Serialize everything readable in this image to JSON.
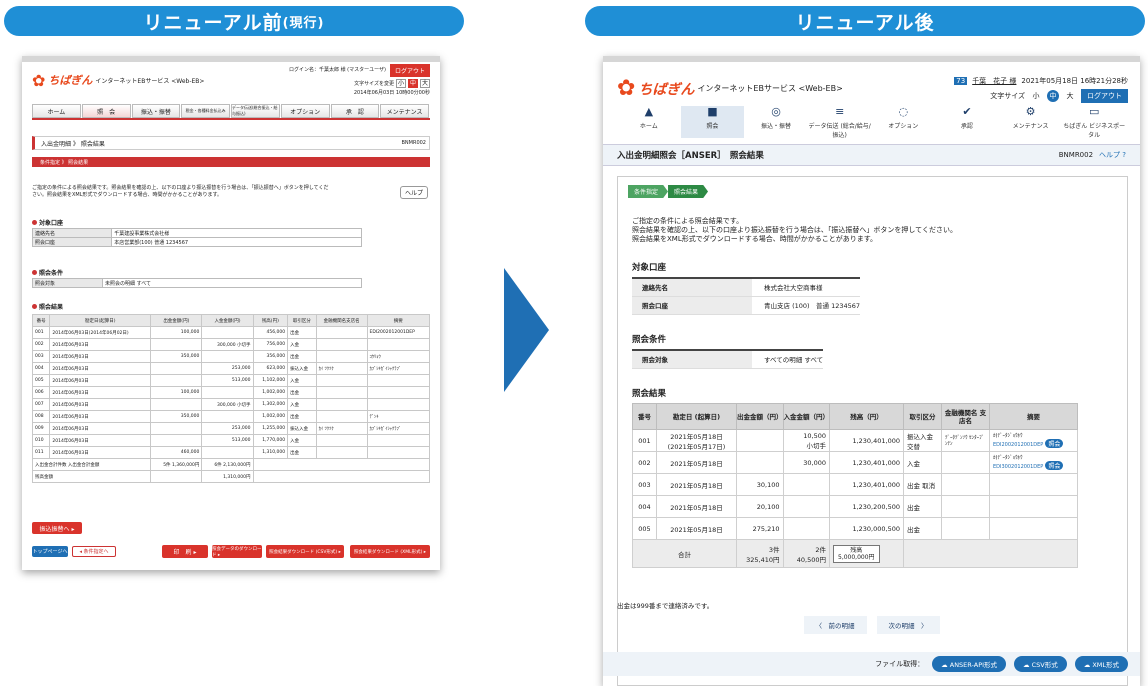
{
  "headers": {
    "before": "リニューアル前",
    "before_sub": "(現行)",
    "after": "リニューアル後"
  },
  "before": {
    "brand": "ちばぎん",
    "service": "インターネットEBサービス <Web-EB>",
    "login_info": "ログイン名：千葉太郎 様 (マスターユーザ)",
    "logout": "ログアウト",
    "font_size_label": "文字サイズを変更",
    "font_sizes": [
      "小",
      "中",
      "大"
    ],
    "datetime": "2014年06月03日 10時00分00秒",
    "nav": [
      "ホーム",
      "照　会",
      "振込・振替",
      "税金・各種料金払込み",
      "データ伝送(総合振込・給与振込)",
      "オプション",
      "承　認",
      "メンテナンス"
    ],
    "crumb": "入出金明細 》 照会結果",
    "screen_id": "BNMR002",
    "step": "条件指定 》 照会結果",
    "intro": "ご指定の条件による照会結果です。照会結果を確認の上、以下の口座より振込振替を行う場合は、「振込振替へ」ボタンを押してください。照会結果をXML形式でダウンロードする場合、時間がかかることがあります。",
    "help": "ヘルプ",
    "sec_account": "対象口座",
    "acc_rows": [
      [
        "連絡先名",
        "千葉建設事業株式会社様"
      ],
      [
        "照会口座",
        "本店営業部(100) 普通 1234567"
      ]
    ],
    "sec_cond": "照会条件",
    "cond_rows": [
      [
        "照会対象",
        "未照会の明細 すべて"
      ]
    ],
    "sec_result": "照会結果",
    "res_headers": [
      "番号",
      "勘定日(起算日)",
      "出金金額(円)",
      "入金金額(円)",
      "残高(円)",
      "取引区分",
      "金融機関名支店名",
      "摘要"
    ],
    "res_rows": [
      [
        "001",
        "2014年06月03日(2014年06月02日)",
        "100,000",
        "",
        "456,000",
        "出金",
        "",
        "EDI2002012001DEP"
      ],
      [
        "002",
        "2014年06月03日",
        "",
        "300,000 小切手",
        "756,000",
        "入金",
        "",
        ""
      ],
      [
        "003",
        "2014年06月03日",
        "350,000",
        "",
        "356,000",
        "出金",
        "",
        "ｺｳﾘｮｳ"
      ],
      [
        "004",
        "2014年06月03日",
        "",
        "253,000",
        "623,000",
        "振込入金",
        "ｶｲ ﾂｸﾂｸ",
        "ｶﾌﾞｼｷｶﾞｲｼｬｸﾗﾌﾞ"
      ],
      [
        "005",
        "2014年06月03日",
        "",
        "513,000",
        "1,102,000",
        "入金",
        "",
        ""
      ],
      [
        "006",
        "2014年06月03日",
        "100,000",
        "",
        "1,002,000",
        "出金",
        "",
        ""
      ],
      [
        "007",
        "2014年06月03日",
        "",
        "300,000 小切手",
        "1,302,000",
        "入金",
        "",
        ""
      ],
      [
        "008",
        "2014年06月03日",
        "350,000",
        "",
        "1,002,000",
        "出金",
        "",
        "ﾃﾞﾝｷ"
      ],
      [
        "009",
        "2014年06月03日",
        "",
        "253,000",
        "1,255,000",
        "振込入金",
        "ｶｲ ﾂｸﾂｸ",
        "ｶﾌﾞｼｷｶﾞｲｼｬｸﾗﾌﾞ"
      ],
      [
        "010",
        "2014年06月03日",
        "",
        "513,000",
        "1,770,000",
        "入金",
        "",
        ""
      ],
      [
        "011",
        "2014年06月03日",
        "460,000",
        "",
        "1,310,000",
        "出金",
        "",
        ""
      ]
    ],
    "res_total_label": "入出金合計件数 入出金合計金額",
    "res_total_out": "5件 1,360,000円",
    "res_total_in": "6件 2,130,000円",
    "res_balance_label": "残高金額",
    "res_balance": "1,310,000円",
    "btn_transfer": "振込振替へ ▸",
    "btn_top": "トップページへ",
    "btn_back": "◂ 条件指定へ",
    "btn_print": "印　刷 ▸",
    "btn_dl": "照会データのダウンロード ▸",
    "btn_csv": "照会結果ダウンロード (CSV形式) ▸",
    "btn_xml": "照会結果ダウンロード (XML形式) ▸"
  },
  "after": {
    "brand": "ちばぎん",
    "service": "インターネットEBサービス <Web-EB>",
    "user_tag": "73",
    "user": "千葉　花子 様",
    "datetime": "2021年05月18日 16時21分28秒",
    "font_size_label": "文字サイズ",
    "font_sizes": [
      "小",
      "中",
      "大"
    ],
    "logout": "ログアウト",
    "nav": [
      {
        "icon": "▲",
        "label": "ホーム"
      },
      {
        "icon": "■",
        "label": "照会"
      },
      {
        "icon": "◎",
        "label": "振込・振替"
      },
      {
        "icon": "≡",
        "label": "データ伝送 (総合/給与/振込)"
      },
      {
        "icon": "◌",
        "label": "オプション"
      },
      {
        "icon": "✔",
        "label": "承認"
      },
      {
        "icon": "⚙",
        "label": "メンテナンス"
      },
      {
        "icon": "▭",
        "label": "ちばぎん ビジネスポータル"
      }
    ],
    "title": "入出金明細照会［ANSER］　照会結果",
    "screen_id": "BNMR002",
    "help": "ヘルプ ?",
    "steps": [
      "条件指定",
      "照会結果"
    ],
    "intro": [
      "ご指定の条件による照会結果です。",
      "照会結果を確認の上、以下の口座より振込振替を行う場合は、「振込振替へ」ボタンを押してください。",
      "照会結果をXML形式でダウンロードする場合、時間がかかることがあります。"
    ],
    "sec_account": "対象口座",
    "acc_rows": [
      [
        "連絡先名",
        "株式会社大空商事様"
      ],
      [
        "照会口座",
        "青山支店 (100)　普通 1234567"
      ]
    ],
    "sec_cond": "照会条件",
    "cond_rows": [
      [
        "照会対象",
        "すべての明細 すべて"
      ]
    ],
    "sec_result": "照会結果",
    "res_headers": [
      "番号",
      "勘定日 (起算日)",
      "出金金額（円）",
      "入金金額（円）",
      "残高（円）",
      "取引区分",
      "金融機関名 支店名",
      "摘要"
    ],
    "res_rows": [
      {
        "no": "001",
        "date": "2021年05月18日",
        "date2": "(2021年05月17日)",
        "out": "",
        "in": "10,500",
        "in2": "小切手",
        "bal": "1,230,401,000",
        "kind": "振込入金 交替",
        "bank": "ﾃﾞｰﾀﾃﾞﾝｿｳ ｾﾝﾀｰﾌﾞﾝﾃﾝ",
        "memo": "ｶ)ﾃﾞｰﾀｼﾞｮｳﾎｳ",
        "memo2": "EDI2002012001DEP",
        "ref": "照会"
      },
      {
        "no": "002",
        "date": "2021年05月18日",
        "date2": "",
        "out": "",
        "in": "30,000",
        "in2": "",
        "bal": "1,230,401,000",
        "kind": "入金",
        "bank": "",
        "memo": "ｶ)ﾃﾞｰﾀｼﾞｮｳﾎｳ",
        "memo2": "EDI3002012001DEP",
        "ref": "照会"
      },
      {
        "no": "003",
        "date": "2021年05月18日",
        "date2": "",
        "out": "30,100",
        "in": "",
        "in2": "",
        "bal": "1,230,401,000",
        "kind": "出金 取消",
        "bank": "",
        "memo": "",
        "memo2": "",
        "ref": ""
      },
      {
        "no": "004",
        "date": "2021年05月18日",
        "date2": "",
        "out": "20,100",
        "in": "",
        "in2": "",
        "bal": "1,230,200,500",
        "kind": "出金",
        "bank": "",
        "memo": "",
        "memo2": "",
        "ref": ""
      },
      {
        "no": "005",
        "date": "2021年05月18日",
        "date2": "",
        "out": "275,210",
        "in": "",
        "in2": "",
        "bal": "1,230,000,500",
        "kind": "出金",
        "bank": "",
        "memo": "",
        "memo2": "",
        "ref": ""
      }
    ],
    "total_label": "合計",
    "total_out_count": "3件",
    "total_out": "325,410円",
    "total_in_count": "2件",
    "total_in": "40,500円",
    "total_bal_label": "残高",
    "total_bal": "5,000,000円",
    "note": "出金は999番まで連絡済みです。",
    "prev": "〈　前の明細",
    "next": "次の明細　〉",
    "file_label": "ファイル取得：",
    "dl": [
      "ANSER-API形式",
      "CSV形式",
      "XML形式"
    ]
  }
}
